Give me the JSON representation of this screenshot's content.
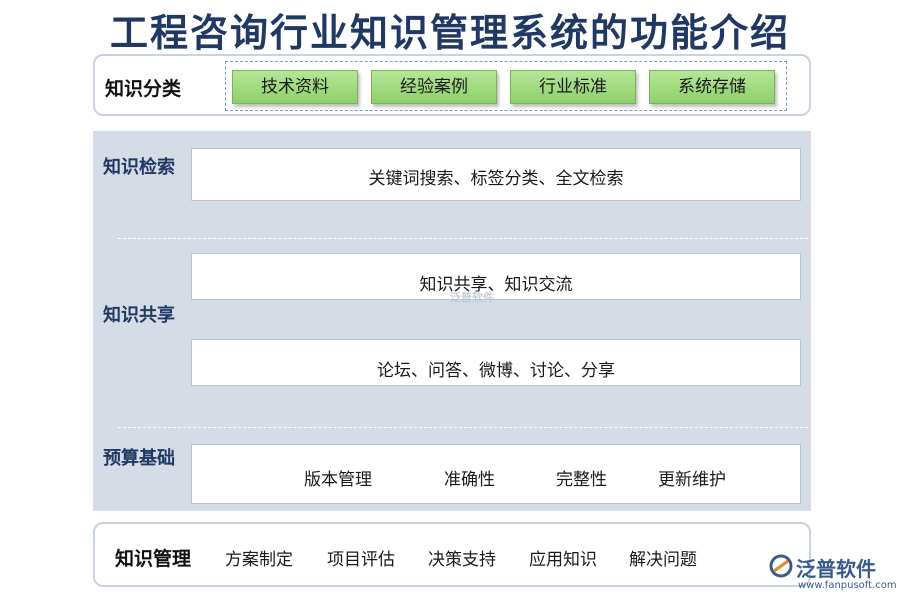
{
  "title": "工程咨询行业知识管理系统的功能介绍",
  "classification": {
    "label": "知识分类",
    "items": [
      "技术资料",
      "经验案例",
      "行业标准",
      "系统存储"
    ]
  },
  "retrieval": {
    "label": "知识检索",
    "content": "关键词搜索、标签分类、全文检索"
  },
  "sharing": {
    "label": "知识共享",
    "content1": "知识共享、知识交流",
    "content2": "论坛、问答、微博、讨论、分享"
  },
  "budget": {
    "label": "预算基础",
    "items": [
      "版本管理",
      "准确性",
      "完整性",
      "更新维护"
    ]
  },
  "management": {
    "label": "知识管理",
    "items": [
      "方案制定",
      "项目评估",
      "决策支持",
      "应用知识",
      "解决问题"
    ]
  },
  "watermark": "泛普软件",
  "logo": {
    "name": "泛普软件",
    "url": "www.fanpusoft.com"
  },
  "colors": {
    "title": "#1f3864",
    "panel": "#d6dce5",
    "green_button": "#8fd06a"
  }
}
